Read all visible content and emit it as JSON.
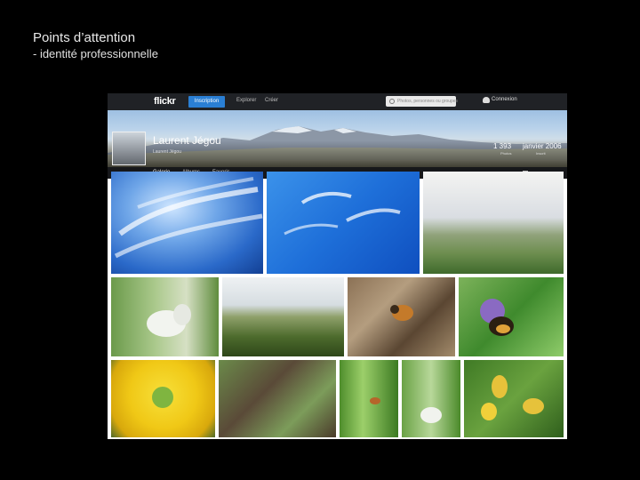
{
  "slide": {
    "title": "Points d’attention",
    "subtitle": "- identité professionnelle"
  },
  "flickr": {
    "logo": "flickr",
    "signup_label": "Inscription",
    "nav": [
      "Explorer",
      "Créer"
    ],
    "search_placeholder": "Photos, personnes ou groupes",
    "signin_label": "Connexion",
    "profile": {
      "name": "Laurent Jégou",
      "handle": "Laurent Jégou",
      "photos_count": "1 393",
      "photos_label": "Photos",
      "joined": "janvier 2006",
      "joined_label": "Inscrit"
    },
    "tabs": [
      "Galerie",
      "Albums",
      "Favoris"
    ],
    "photos": [
      {
        "name": "cirrus-clouds-1",
        "subject": "cirrus clouds"
      },
      {
        "name": "cirrus-clouds-2",
        "subject": "cirrus clouds"
      },
      {
        "name": "countryside-landscape",
        "subject": "landscape"
      },
      {
        "name": "white-butterfly",
        "subject": "butterfly"
      },
      {
        "name": "forest-valley",
        "subject": "landscape"
      },
      {
        "name": "bee-fly-leaves",
        "subject": "insect"
      },
      {
        "name": "bumblebee-flower",
        "subject": "insect"
      },
      {
        "name": "yellow-flower",
        "subject": "flower"
      },
      {
        "name": "grass-twigs",
        "subject": "ground"
      },
      {
        "name": "insect-on-grass",
        "subject": "insect"
      },
      {
        "name": "butterfly-on-stem",
        "subject": "butterfly"
      },
      {
        "name": "yellow-orchid",
        "subject": "flower"
      }
    ]
  }
}
